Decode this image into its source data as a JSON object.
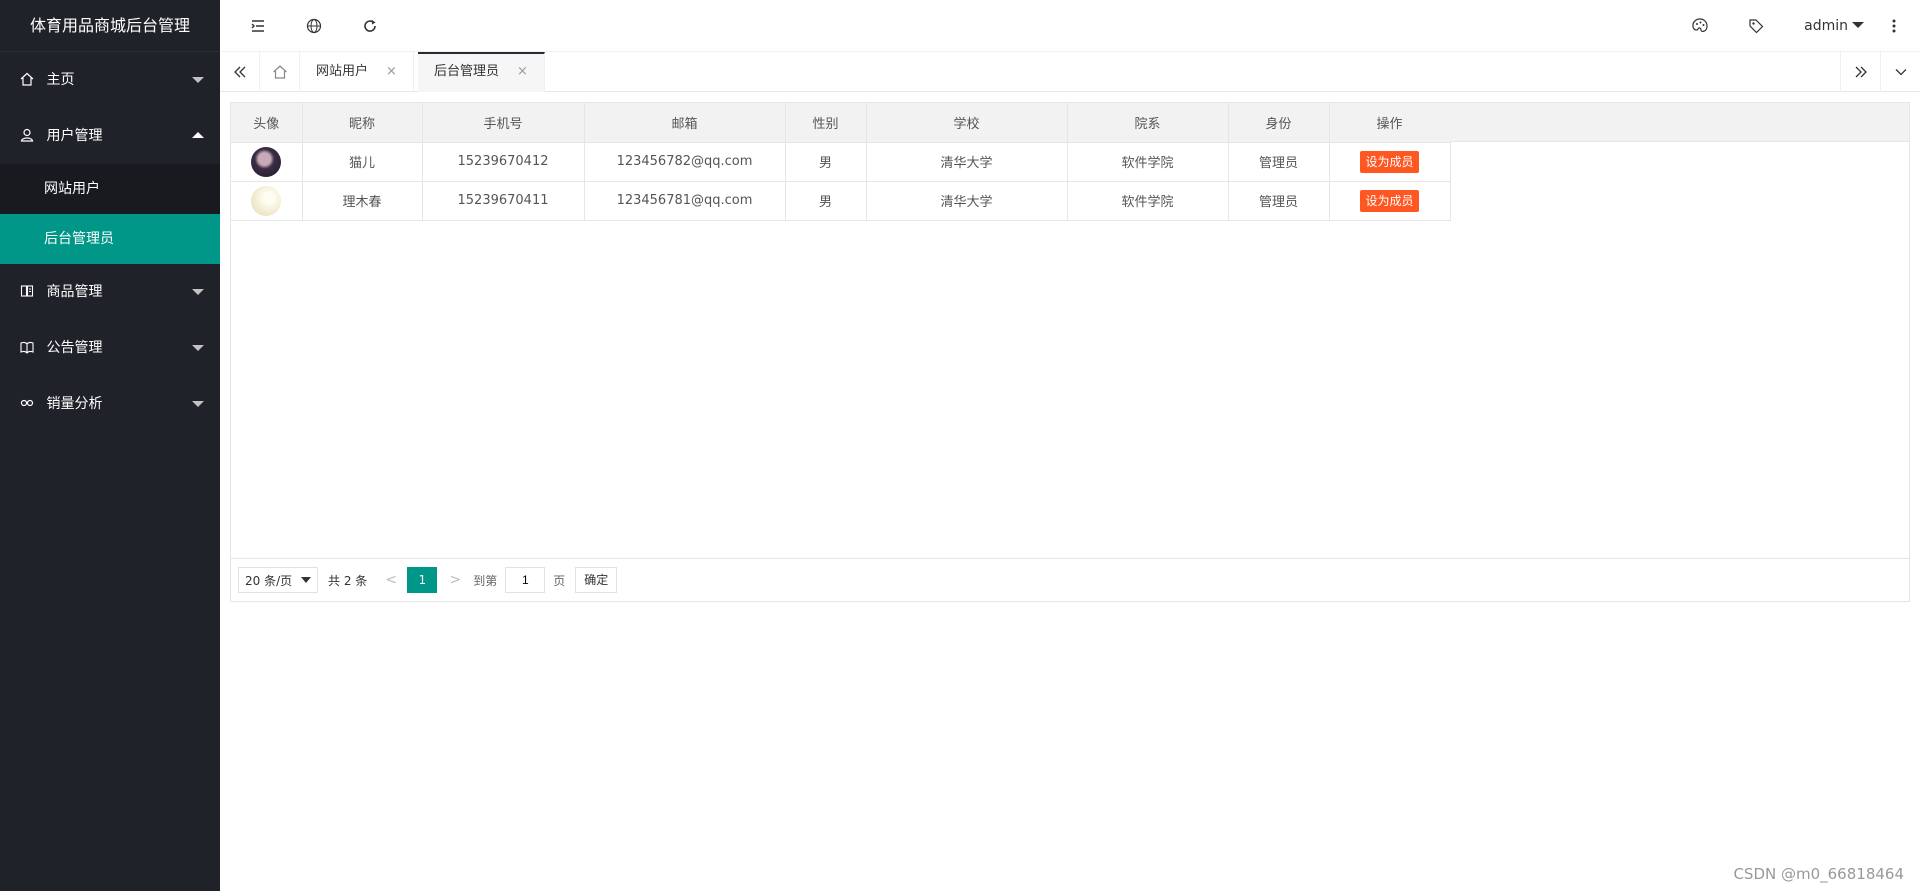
{
  "app": {
    "title": "体育用品商城后台管理"
  },
  "sidebar": {
    "items": [
      {
        "label": "主页",
        "icon": "home-icon"
      },
      {
        "label": "用户管理",
        "icon": "user-icon",
        "children": [
          {
            "label": "网站用户"
          },
          {
            "label": "后台管理员"
          }
        ]
      },
      {
        "label": "商品管理",
        "icon": "goods-icon"
      },
      {
        "label": "公告管理",
        "icon": "notice-icon"
      },
      {
        "label": "销量分析",
        "icon": "analysis-icon"
      }
    ]
  },
  "header": {
    "user": "admin",
    "icons": [
      "menu-toggle-icon",
      "globe-icon",
      "refresh-icon",
      "theme-icon",
      "tag-icon",
      "more-icon"
    ]
  },
  "tabs": [
    {
      "label": "网站用户",
      "close": "×"
    },
    {
      "label": "后台管理员",
      "close": "×"
    }
  ],
  "table": {
    "headers": [
      "头像",
      "昵称",
      "手机号",
      "邮箱",
      "性别",
      "学校",
      "院系",
      "身份",
      "操作"
    ],
    "rows": [
      {
        "nickname": "猫儿",
        "phone": "15239670412",
        "email": "123456782@qq.com",
        "gender": "男",
        "school": "清华大学",
        "dept": "软件学院",
        "role": "管理员",
        "action": "设为成员"
      },
      {
        "nickname": "理木春",
        "phone": "15239670411",
        "email": "123456781@qq.com",
        "gender": "男",
        "school": "清华大学",
        "dept": "软件学院",
        "role": "管理员",
        "action": "设为成员"
      }
    ]
  },
  "pager": {
    "page_size": "20 条/页",
    "total": "共 2 条",
    "current": "1",
    "goto_label": "到第",
    "goto_value": "1",
    "page_unit": "页",
    "confirm": "确定",
    "prev": "<",
    "next": ">"
  },
  "watermark": "CSDN @m0_66818464",
  "colors": {
    "sidebar_bg": "#20222a",
    "active": "#009688",
    "action_button": "#ff5722"
  }
}
